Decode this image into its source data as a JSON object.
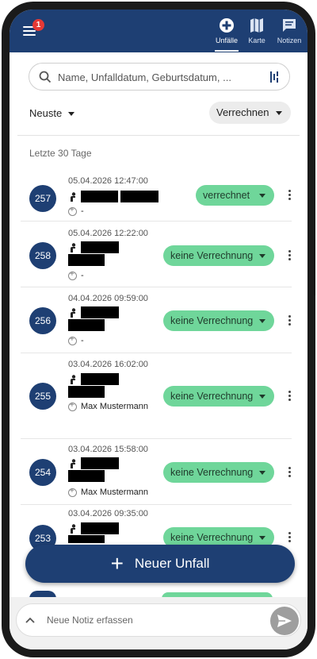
{
  "nav": {
    "badge_count": "1",
    "items": [
      {
        "label": "Unfälle",
        "icon": "plus-circle-icon",
        "active": true
      },
      {
        "label": "Karte",
        "icon": "map-icon",
        "active": false
      },
      {
        "label": "Notizen",
        "icon": "notes-icon",
        "active": false
      }
    ]
  },
  "search": {
    "placeholder": "Name, Unfalldatum, Geburtsdatum, ..."
  },
  "filters": {
    "sort_label": "Neuste",
    "billing_label": "Verrechnen"
  },
  "section": {
    "label": "Letzte 30 Tage"
  },
  "cases": [
    {
      "number": "257",
      "datetime": "05.04.2026 12:47:00",
      "doctor": "-",
      "status": "verrechnet"
    },
    {
      "number": "258",
      "datetime": "05.04.2026 12:22:00",
      "doctor": "-",
      "status": "keine Verrechnung"
    },
    {
      "number": "256",
      "datetime": "04.04.2026 09:59:00",
      "doctor": "-",
      "status": "keine Verrechnung"
    },
    {
      "number": "255",
      "datetime": "03.04.2026 16:02:00",
      "doctor": "Max Mustermann",
      "status": "keine Verrechnung"
    },
    {
      "number": "254",
      "datetime": "03.04.2026 15:58:00",
      "doctor": "Max Mustermann",
      "status": "keine Verrechnung"
    },
    {
      "number": "253",
      "datetime": "03.04.2026 09:35:00",
      "doctor": "",
      "status": "keine Verrechnung"
    }
  ],
  "fab": {
    "label": "Neuer Unfall"
  },
  "note": {
    "placeholder": "Neue Notiz erfassen"
  },
  "colors": {
    "primary": "#1e3f73",
    "status_green": "#6fd69a",
    "badge": "#e53935"
  }
}
